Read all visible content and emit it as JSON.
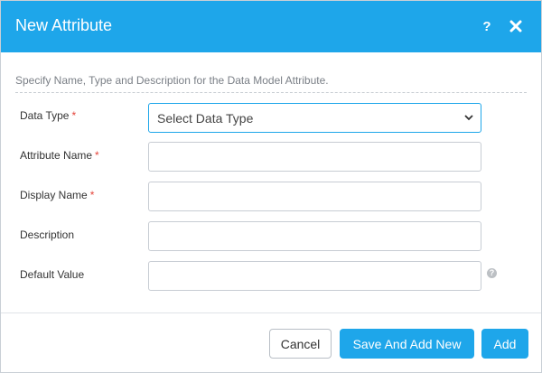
{
  "dialog": {
    "title": "New Attribute",
    "help_icon_glyph": "?",
    "intro": "Specify Name, Type and Description for the Data Model Attribute."
  },
  "icons": {
    "help": "help-icon",
    "close": "close-icon",
    "dropdown": "chevron-down-icon",
    "info": "info-icon"
  },
  "form": {
    "required_marker": "*",
    "data_type": {
      "label": "Data Type",
      "selected": "Select Data Type"
    },
    "attribute_name": {
      "label": "Attribute Name",
      "value": ""
    },
    "display_name": {
      "label": "Display Name",
      "value": ""
    },
    "description": {
      "label": "Description",
      "value": ""
    },
    "default_value": {
      "label": "Default Value",
      "value": ""
    }
  },
  "footer": {
    "cancel_label": "Cancel",
    "save_and_add_new_label": "Save And Add New",
    "add_label": "Add"
  },
  "colors": {
    "accent": "#1ea6ea",
    "required": "#e4443a",
    "border": "#c7ccd3"
  }
}
